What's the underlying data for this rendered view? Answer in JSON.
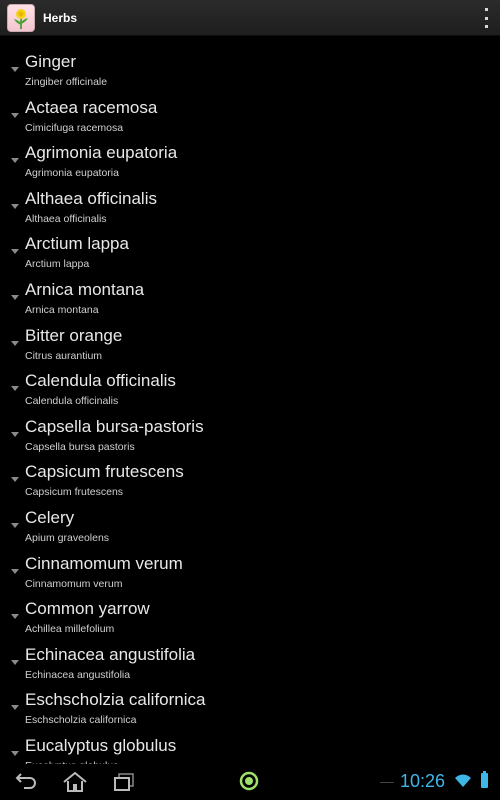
{
  "app": {
    "title": "Herbs",
    "icon": "dandelion-icon"
  },
  "herbs": [
    {
      "name": " Ginger",
      "latin": "Zingiber officinale"
    },
    {
      "name": "Actaea racemosa",
      "latin": "Cimicifuga racemosa"
    },
    {
      "name": "Agrimonia eupatoria",
      "latin": "Agrimonia eupatoria"
    },
    {
      "name": "Althaea officinalis",
      "latin": "Althaea officinalis"
    },
    {
      "name": "Arctium lappa",
      "latin": "Arctium lappa"
    },
    {
      "name": "Arnica montana",
      "latin": "Arnica montana"
    },
    {
      "name": "Bitter orange",
      "latin": "Citrus aurantium"
    },
    {
      "name": "Calendula officinalis",
      "latin": "Calendula officinalis"
    },
    {
      "name": "Capsella bursa-pastoris",
      "latin": "Capsella bursa pastoris"
    },
    {
      "name": "Capsicum frutescens",
      "latin": "Capsicum frutescens"
    },
    {
      "name": "Celery",
      "latin": "Apium graveolens"
    },
    {
      "name": "Cinnamomum verum",
      "latin": "Cinnamomum verum"
    },
    {
      "name": "Common yarrow",
      "latin": "Achillea millefolium"
    },
    {
      "name": "Echinacea angustifolia",
      "latin": "Echinacea angustifolia"
    },
    {
      "name": "Eschscholzia californica",
      "latin": "Eschscholzia californica"
    },
    {
      "name": "Eucalyptus globulus",
      "latin": "Eucalyptus globulus"
    }
  ],
  "status": {
    "time": "10:26"
  },
  "colors": {
    "accent": "#3fb6e8",
    "background": "#000000"
  }
}
